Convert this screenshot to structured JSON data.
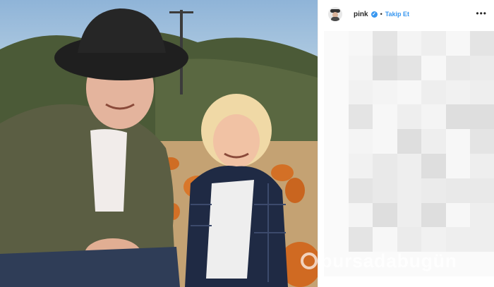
{
  "post": {
    "username": "pink",
    "verified_icon": "verified-badge-icon",
    "separator": "•",
    "follow_label": "Takip Et",
    "more_label": "•••"
  },
  "watermark": {
    "text": "bursadabugün"
  },
  "colors": {
    "link_blue": "#3897f0",
    "text_dark": "#262626"
  }
}
